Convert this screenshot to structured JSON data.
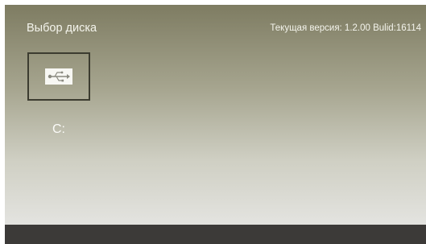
{
  "header": {
    "title": "Выбор диска",
    "version": "Текущая версия: 1.2.00 Bulid:16114"
  },
  "drives": [
    {
      "label": "C:",
      "icon": "usb-icon"
    }
  ],
  "colors": {
    "gradient_top": "#7e7c62",
    "gradient_bottom": "#e6e6e4",
    "text": "#f4f4ec",
    "tile_border": "#3c3c30",
    "bottom_bar": "#3c3a38"
  }
}
